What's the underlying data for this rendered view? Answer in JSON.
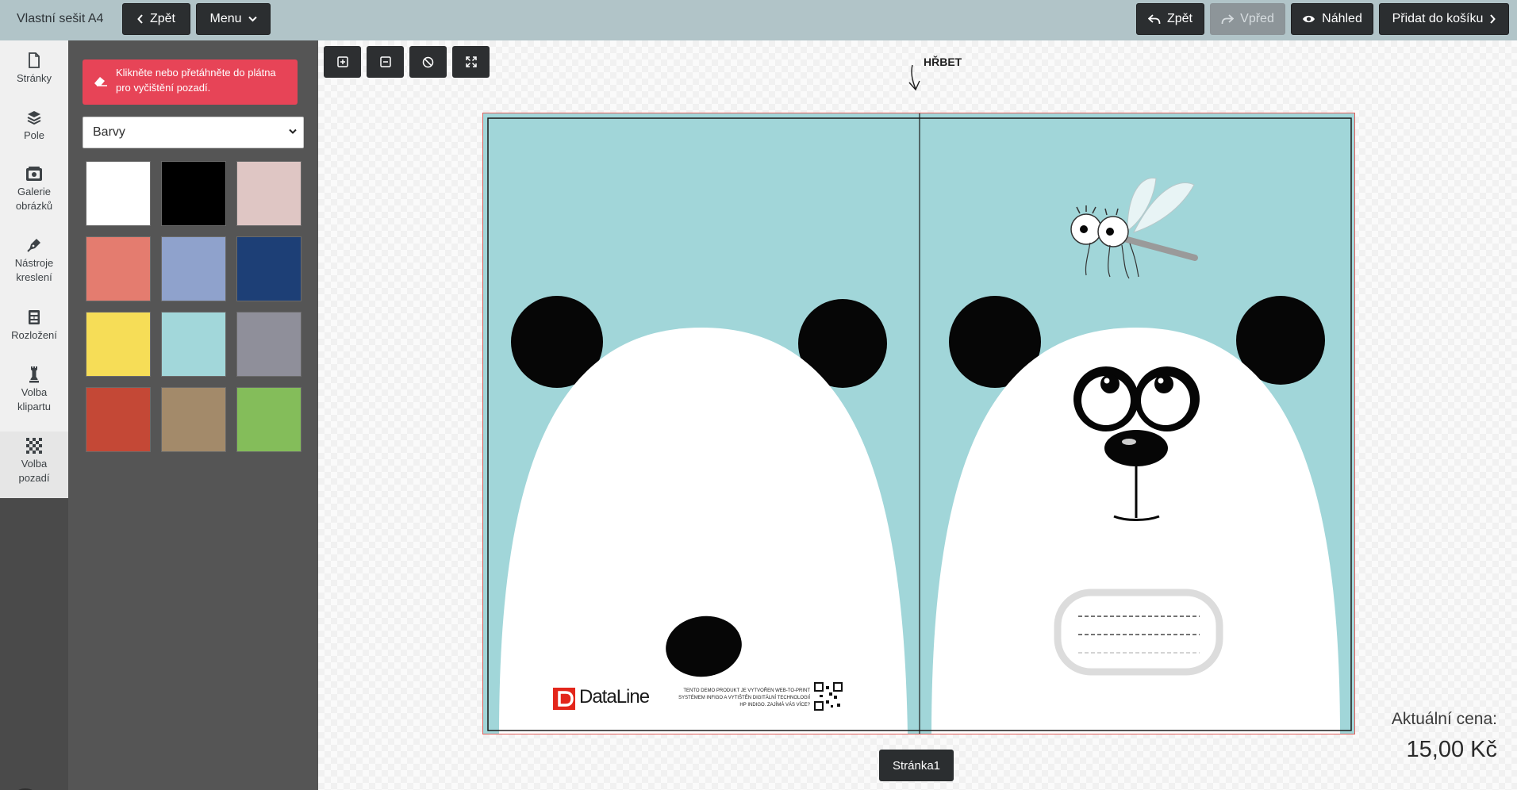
{
  "topbar": {
    "title": "Vlastní sešit A4",
    "back_label": "Zpět",
    "menu_label": "Menu",
    "undo_label": "Zpět",
    "redo_label": "Vpřed",
    "preview_label": "Náhled",
    "add_to_cart_label": "Přidat do košíku"
  },
  "sidebar": {
    "items": [
      {
        "label_lines": [
          "Stránky"
        ],
        "icon": "page-icon"
      },
      {
        "label_lines": [
          "Pole"
        ],
        "icon": "layers-icon"
      },
      {
        "label_lines": [
          "Galerie",
          "obrázků"
        ],
        "icon": "gallery-icon"
      },
      {
        "label_lines": [
          "Nástroje",
          "kreslení"
        ],
        "icon": "pen-icon"
      },
      {
        "label_lines": [
          "Rozložení"
        ],
        "icon": "layout-icon"
      },
      {
        "label_lines": [
          "Volba",
          "klipartu"
        ],
        "icon": "chess-piece-icon"
      },
      {
        "label_lines": [
          "Volba",
          "pozadí"
        ],
        "icon": "checkerboard-icon"
      }
    ]
  },
  "panel": {
    "alert_lines": [
      "Klikněte nebo přetáhněte do plátna",
      "pro vyčištění pozadí."
    ],
    "select_value": "Barvy",
    "swatches": [
      "#ffffff",
      "#000000",
      "#dfc6c4",
      "#e47c6f",
      "#8fa2cc",
      "#1d3f76",
      "#f6dd57",
      "#a2d7da",
      "#8f8f9a",
      "#c44836",
      "#a38a6a",
      "#84bd5a"
    ]
  },
  "canvas": {
    "spine_label": "HŘBET",
    "background_color": "#a1d6d9",
    "logo_text": "DataLine",
    "demo_text_lines": [
      "TENTO DEMO PRODUKT JE VYTVOŘEN WEB-TO-PRINT",
      "SYSTÉMEM INFIGO A VYTIŠTĚN DIGITÁLNÍ TECHNOLOGIÍ",
      "HP INDIGO. ZAJÍMÁ VÁS VÍCE?"
    ],
    "page_label": "Stránka1"
  },
  "price": {
    "label": "Aktuální cena:",
    "value": "15,00 Kč"
  }
}
